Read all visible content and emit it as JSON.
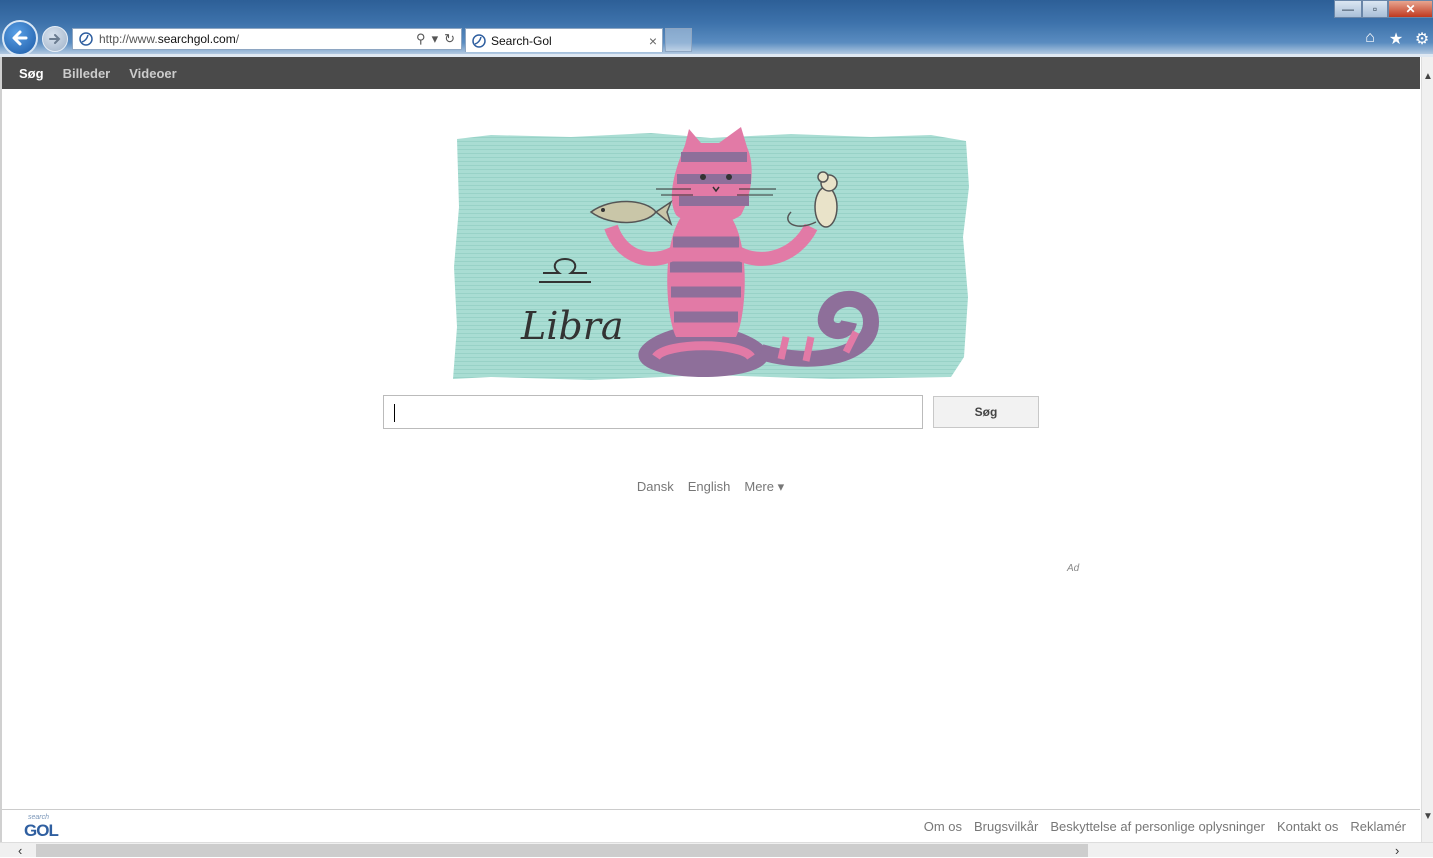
{
  "browser": {
    "url_prefix": "http://www.",
    "url_domain": "searchgol.com",
    "url_suffix": "/",
    "tab_title": "Search-Gol",
    "tab_close": "×",
    "win_min": "—",
    "win_max": "▫",
    "win_close": "✕",
    "home_icon": "⌂",
    "favorites_icon": "★",
    "tools_icon": "⚙"
  },
  "topnav": {
    "items": [
      "Søg",
      "Billeder",
      "Videoer"
    ]
  },
  "banner": {
    "caption": "Libra",
    "symbol": "♎"
  },
  "search": {
    "button_label": "Søg",
    "value": ""
  },
  "languages": {
    "items": [
      "Dansk",
      "English"
    ],
    "more": "Mere ▾"
  },
  "ad_label": "Ad",
  "footer": {
    "logo_top": "search",
    "logo_text": "GOL",
    "links": [
      "Om os",
      "Brugsvilkår",
      "Beskyttelse af personlige oplysninger",
      "Kontakt os",
      "Reklamér"
    ]
  },
  "colors": {
    "banner_bg": "#a9ddd3",
    "cat_pink": "#e27aa6",
    "cat_purple": "#8e6f9a",
    "nav_bg": "#4a4a4a"
  }
}
